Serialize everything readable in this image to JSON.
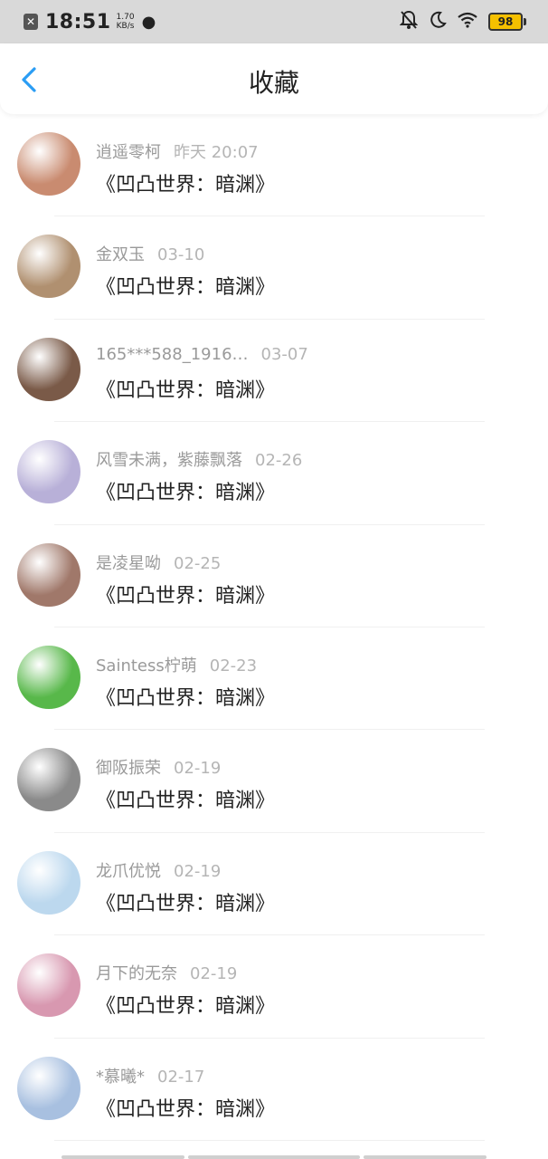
{
  "status_bar": {
    "time": "18:51",
    "speed_value": "1.70",
    "speed_unit": "KB/s",
    "battery": "98"
  },
  "header": {
    "title": "收藏"
  },
  "items": [
    {
      "user": "逍遥零柯",
      "date": "昨天 20:07",
      "work": "《凹凸世界：暗渊》",
      "avatar_color": "#c98b70"
    },
    {
      "user": "金双玉",
      "date": "03-10",
      "work": "《凹凸世界：暗渊》",
      "avatar_color": "#b09070"
    },
    {
      "user": "165***588_1916…",
      "date": "03-07",
      "work": "《凹凸世界：暗渊》",
      "avatar_color": "#7a5a48"
    },
    {
      "user": "风雪未满，紫藤飘落",
      "date": "02-26",
      "work": "《凹凸世界：暗渊》",
      "avatar_color": "#b8b0d8"
    },
    {
      "user": "是凌星呦",
      "date": "02-25",
      "work": "《凹凸世界：暗渊》",
      "avatar_color": "#a0786a"
    },
    {
      "user": "Saintess柠萌",
      "date": "02-23",
      "work": "《凹凸世界：暗渊》",
      "avatar_color": "#58b84a"
    },
    {
      "user": "御阪振荣",
      "date": "02-19",
      "work": "《凹凸世界：暗渊》",
      "avatar_color": "#8a8a8a"
    },
    {
      "user": "龙爪优悦",
      "date": "02-19",
      "work": "《凹凸世界：暗渊》",
      "avatar_color": "#bcd8ee"
    },
    {
      "user": "月下的无奈",
      "date": "02-19",
      "work": "《凹凸世界：暗渊》",
      "avatar_color": "#d898b0"
    },
    {
      "user": "*慕曦*",
      "date": "02-17",
      "work": "《凹凸世界：暗渊》",
      "avatar_color": "#a8c0e0"
    }
  ]
}
